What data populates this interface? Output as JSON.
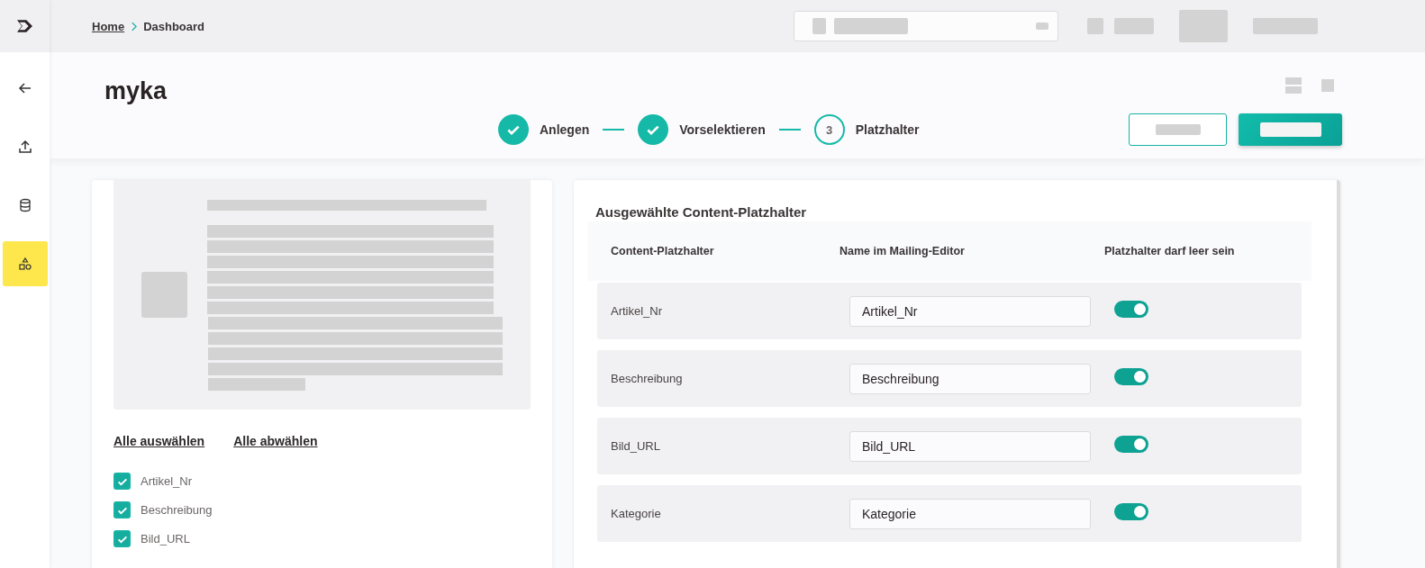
{
  "sidebar": {
    "items": [
      {
        "kind": "back",
        "selected": false
      },
      {
        "kind": "upload",
        "selected": false
      },
      {
        "kind": "database",
        "selected": false
      },
      {
        "kind": "shapes",
        "selected": true
      }
    ]
  },
  "breadcrumb": [
    {
      "label": "Home",
      "kind": "link"
    },
    {
      "label": "Dashboard",
      "kind": "current"
    }
  ],
  "page_title": "myka",
  "steps": [
    {
      "label": "Anlegen",
      "completed": true
    },
    {
      "label": "Vorselektieren",
      "completed": true
    },
    {
      "label": "Platzhalter",
      "completed": false,
      "number": "3"
    }
  ],
  "selection_links": [
    "Alle auswählen",
    "Alle abwählen"
  ],
  "fields": [
    {
      "label": "Artikel_Nr",
      "checked": true
    },
    {
      "label": "Beschreibung",
      "checked": true
    },
    {
      "label": "Bild_URL",
      "checked": true
    }
  ],
  "placeholder_table": {
    "title": "Ausgewählte Content-Platzhalter",
    "columns": [
      "Content-Platzhalter",
      "Name im Mailing-Editor",
      "Platzhalter darf leer sein"
    ],
    "rows": [
      {
        "placeholder": "Artikel_Nr",
        "name": "Artikel_Nr",
        "may_be_empty": true
      },
      {
        "placeholder": "Beschreibung",
        "name": "Beschreibung",
        "may_be_empty": true
      },
      {
        "placeholder": "Bild_URL",
        "name": "Bild_URL",
        "may_be_empty": true
      },
      {
        "placeholder": "Kategorie",
        "name": "Kategorie",
        "may_be_empty": true
      }
    ]
  }
}
